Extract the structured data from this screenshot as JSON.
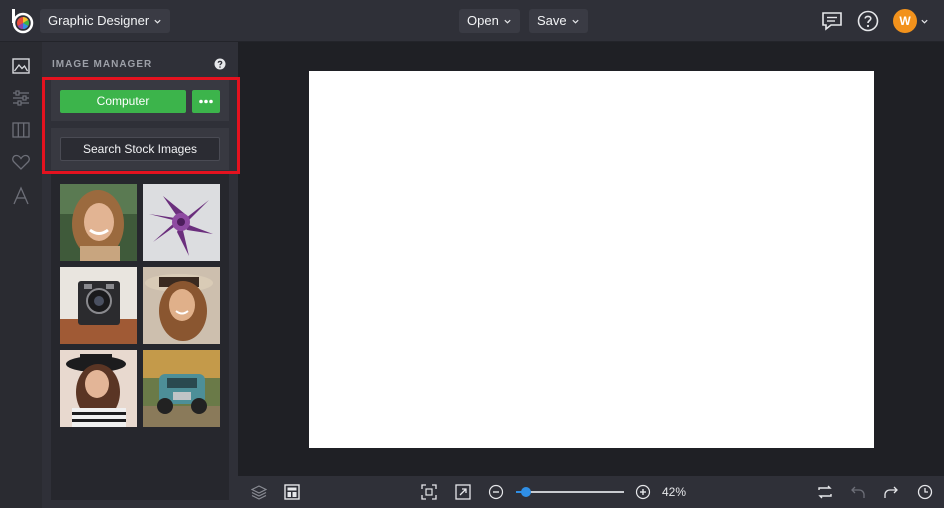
{
  "topbar": {
    "mode_label": "Graphic Designer",
    "open_label": "Open",
    "save_label": "Save",
    "avatar_initial": "W",
    "icons": [
      "logo-icon",
      "chat-icon",
      "help-icon",
      "chevron-down-icon"
    ]
  },
  "sidebar_icons": [
    "image-icon",
    "adjust-icon",
    "layout-icon",
    "heart-icon",
    "text-icon"
  ],
  "image_manager": {
    "title": "IMAGE MANAGER",
    "computer_label": "Computer",
    "stock_label": "Search Stock Images",
    "thumbnails": [
      "woman-smiling",
      "purple-succulent",
      "vintage-camera",
      "woman-in-hat",
      "woman-black-hat",
      "vintage-truck"
    ]
  },
  "bottombar": {
    "zoom_value": "42%",
    "zoom_level": 0.05
  },
  "colors": {
    "accent_green": "#3cb44b",
    "highlight_red": "#e4121f",
    "avatar_orange": "#f2921c",
    "slider_blue": "#2f8fe6"
  }
}
